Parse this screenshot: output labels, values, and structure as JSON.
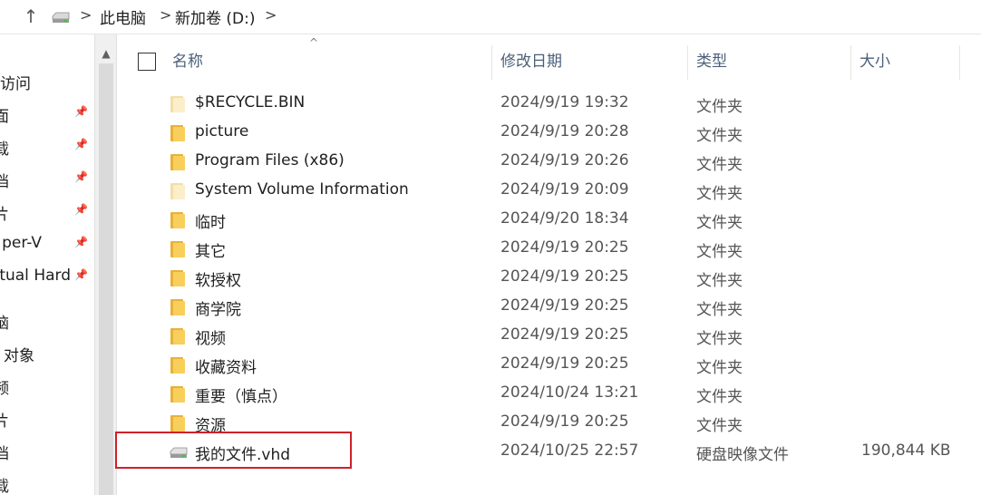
{
  "addressbar": {
    "up_icon": "arrow-up-icon",
    "drive_icon": "drive-icon",
    "separator": ">",
    "breadcrumbs": [
      "此电脑",
      "新加卷 (D:)"
    ]
  },
  "navpane": {
    "items": [
      {
        "label": "访问",
        "pinned": false
      },
      {
        "label": "面",
        "pinned": true
      },
      {
        "label": "载",
        "pinned": true
      },
      {
        "label": "档",
        "pinned": true
      },
      {
        "label": "片",
        "pinned": true
      },
      {
        "label": "per-V",
        "pinned": true
      },
      {
        "label": "tual Hard",
        "pinned": true
      },
      {
        "label": "脑",
        "pinned": false
      },
      {
        "label": "对象",
        "pinned": false
      },
      {
        "label": "频",
        "pinned": false
      },
      {
        "label": "片",
        "pinned": false
      },
      {
        "label": "档",
        "pinned": false
      },
      {
        "label": "载",
        "pinned": false
      }
    ]
  },
  "scrollbar": {
    "up_glyph": "▲"
  },
  "columns": {
    "name": "名称",
    "date": "修改日期",
    "type": "类型",
    "size": "大小",
    "sort_glyph": "^"
  },
  "files": [
    {
      "name": "$RECYCLE.BIN",
      "date": "2024/9/19 19:32",
      "type": "文件夹",
      "size": "",
      "icon": "folder-icon-pale"
    },
    {
      "name": "picture",
      "date": "2024/9/19 20:28",
      "type": "文件夹",
      "size": "",
      "icon": "folder-icon"
    },
    {
      "name": "Program Files (x86)",
      "date": "2024/9/19 20:26",
      "type": "文件夹",
      "size": "",
      "icon": "folder-icon"
    },
    {
      "name": "System Volume Information",
      "date": "2024/9/19 20:09",
      "type": "文件夹",
      "size": "",
      "icon": "folder-icon-pale"
    },
    {
      "name": "临时",
      "date": "2024/9/20 18:34",
      "type": "文件夹",
      "size": "",
      "icon": "folder-icon"
    },
    {
      "name": "其它",
      "date": "2024/9/19 20:25",
      "type": "文件夹",
      "size": "",
      "icon": "folder-icon"
    },
    {
      "name": "软授权",
      "date": "2024/9/19 20:25",
      "type": "文件夹",
      "size": "",
      "icon": "folder-icon"
    },
    {
      "name": "商学院",
      "date": "2024/9/19 20:25",
      "type": "文件夹",
      "size": "",
      "icon": "folder-icon"
    },
    {
      "name": "视频",
      "date": "2024/9/19 20:25",
      "type": "文件夹",
      "size": "",
      "icon": "folder-icon"
    },
    {
      "name": "收藏资料",
      "date": "2024/9/19 20:25",
      "type": "文件夹",
      "size": "",
      "icon": "folder-icon"
    },
    {
      "name": "重要（慎点）",
      "date": "2024/10/24 13:21",
      "type": "文件夹",
      "size": "",
      "icon": "folder-icon"
    },
    {
      "name": "资源",
      "date": "2024/9/19 20:25",
      "type": "文件夹",
      "size": "",
      "icon": "folder-icon"
    },
    {
      "name": "我的文件.vhd",
      "date": "2024/10/25 22:57",
      "type": "硬盘映像文件",
      "size": "190,844 KB",
      "icon": "vhd-drive-icon"
    }
  ],
  "colors": {
    "highlight": "#d0202a",
    "folder": "#f8cf5b",
    "header_text": "#4c607a"
  }
}
